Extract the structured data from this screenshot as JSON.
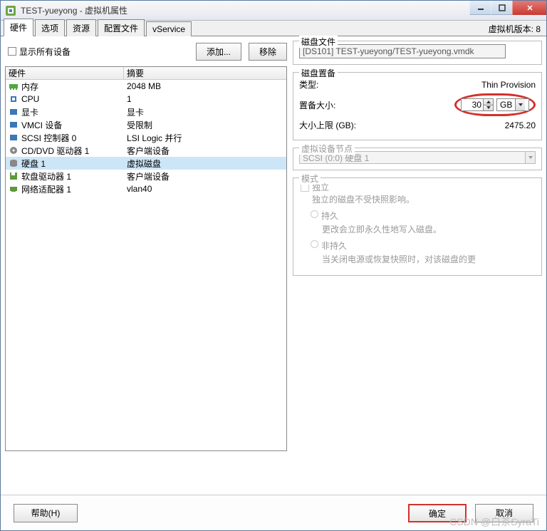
{
  "window": {
    "title": "TEST-yueyong - 虚拟机属性",
    "version_label": "虚拟机版本: 8"
  },
  "tabs": [
    "硬件",
    "选项",
    "资源",
    "配置文件",
    "vService"
  ],
  "active_tab": 0,
  "left": {
    "show_all_devices": "显示所有设备",
    "add_button": "添加...",
    "remove_button": "移除",
    "col_hardware": "硬件",
    "col_summary": "摘要",
    "rows": [
      {
        "icon": "memory",
        "name": "内存",
        "summary": "2048 MB"
      },
      {
        "icon": "cpu",
        "name": "CPU",
        "summary": "1"
      },
      {
        "icon": "video",
        "name": "显卡",
        "summary": "显卡"
      },
      {
        "icon": "vmci",
        "name": "VMCI 设备",
        "summary": "受限制"
      },
      {
        "icon": "scsi",
        "name": "SCSI 控制器 0",
        "summary": "LSI Logic 并行"
      },
      {
        "icon": "cd",
        "name": "CD/DVD 驱动器 1",
        "summary": "客户端设备"
      },
      {
        "icon": "disk",
        "name": "硬盘 1",
        "summary": "虚拟磁盘"
      },
      {
        "icon": "floppy",
        "name": "软盘驱动器 1",
        "summary": "客户端设备"
      },
      {
        "icon": "nic",
        "name": "网络适配器 1",
        "summary": "vlan40"
      }
    ],
    "selected_index": 6
  },
  "right": {
    "disk_file": {
      "title": "磁盘文件",
      "value": "[DS101] TEST-yueyong/TEST-yueyong.vmdk"
    },
    "disk_provision": {
      "title": "磁盘置备",
      "type_label": "类型:",
      "type_value": "Thin Provision",
      "size_label": "置备大小:",
      "size_value": "30",
      "size_unit": "GB",
      "max_label": "大小上限 (GB):",
      "max_value": "2475.20"
    },
    "device_node": {
      "title": "虚拟设备节点",
      "value": "SCSI (0:0) 硬盘 1"
    },
    "mode": {
      "title": "模式",
      "independent": "独立",
      "independent_desc": "独立的磁盘不受快照影响。",
      "persistent": "持久",
      "persistent_desc": "更改会立即永久性地写入磁盘。",
      "nonpersistent": "非持久",
      "nonpersistent_desc": "当关闭电源或恢复快照时，对该磁盘的更"
    }
  },
  "bottom": {
    "help": "帮助(H)",
    "ok": "确定",
    "cancel": "取消"
  },
  "watermark": "CSDN @白茶SyraTi"
}
